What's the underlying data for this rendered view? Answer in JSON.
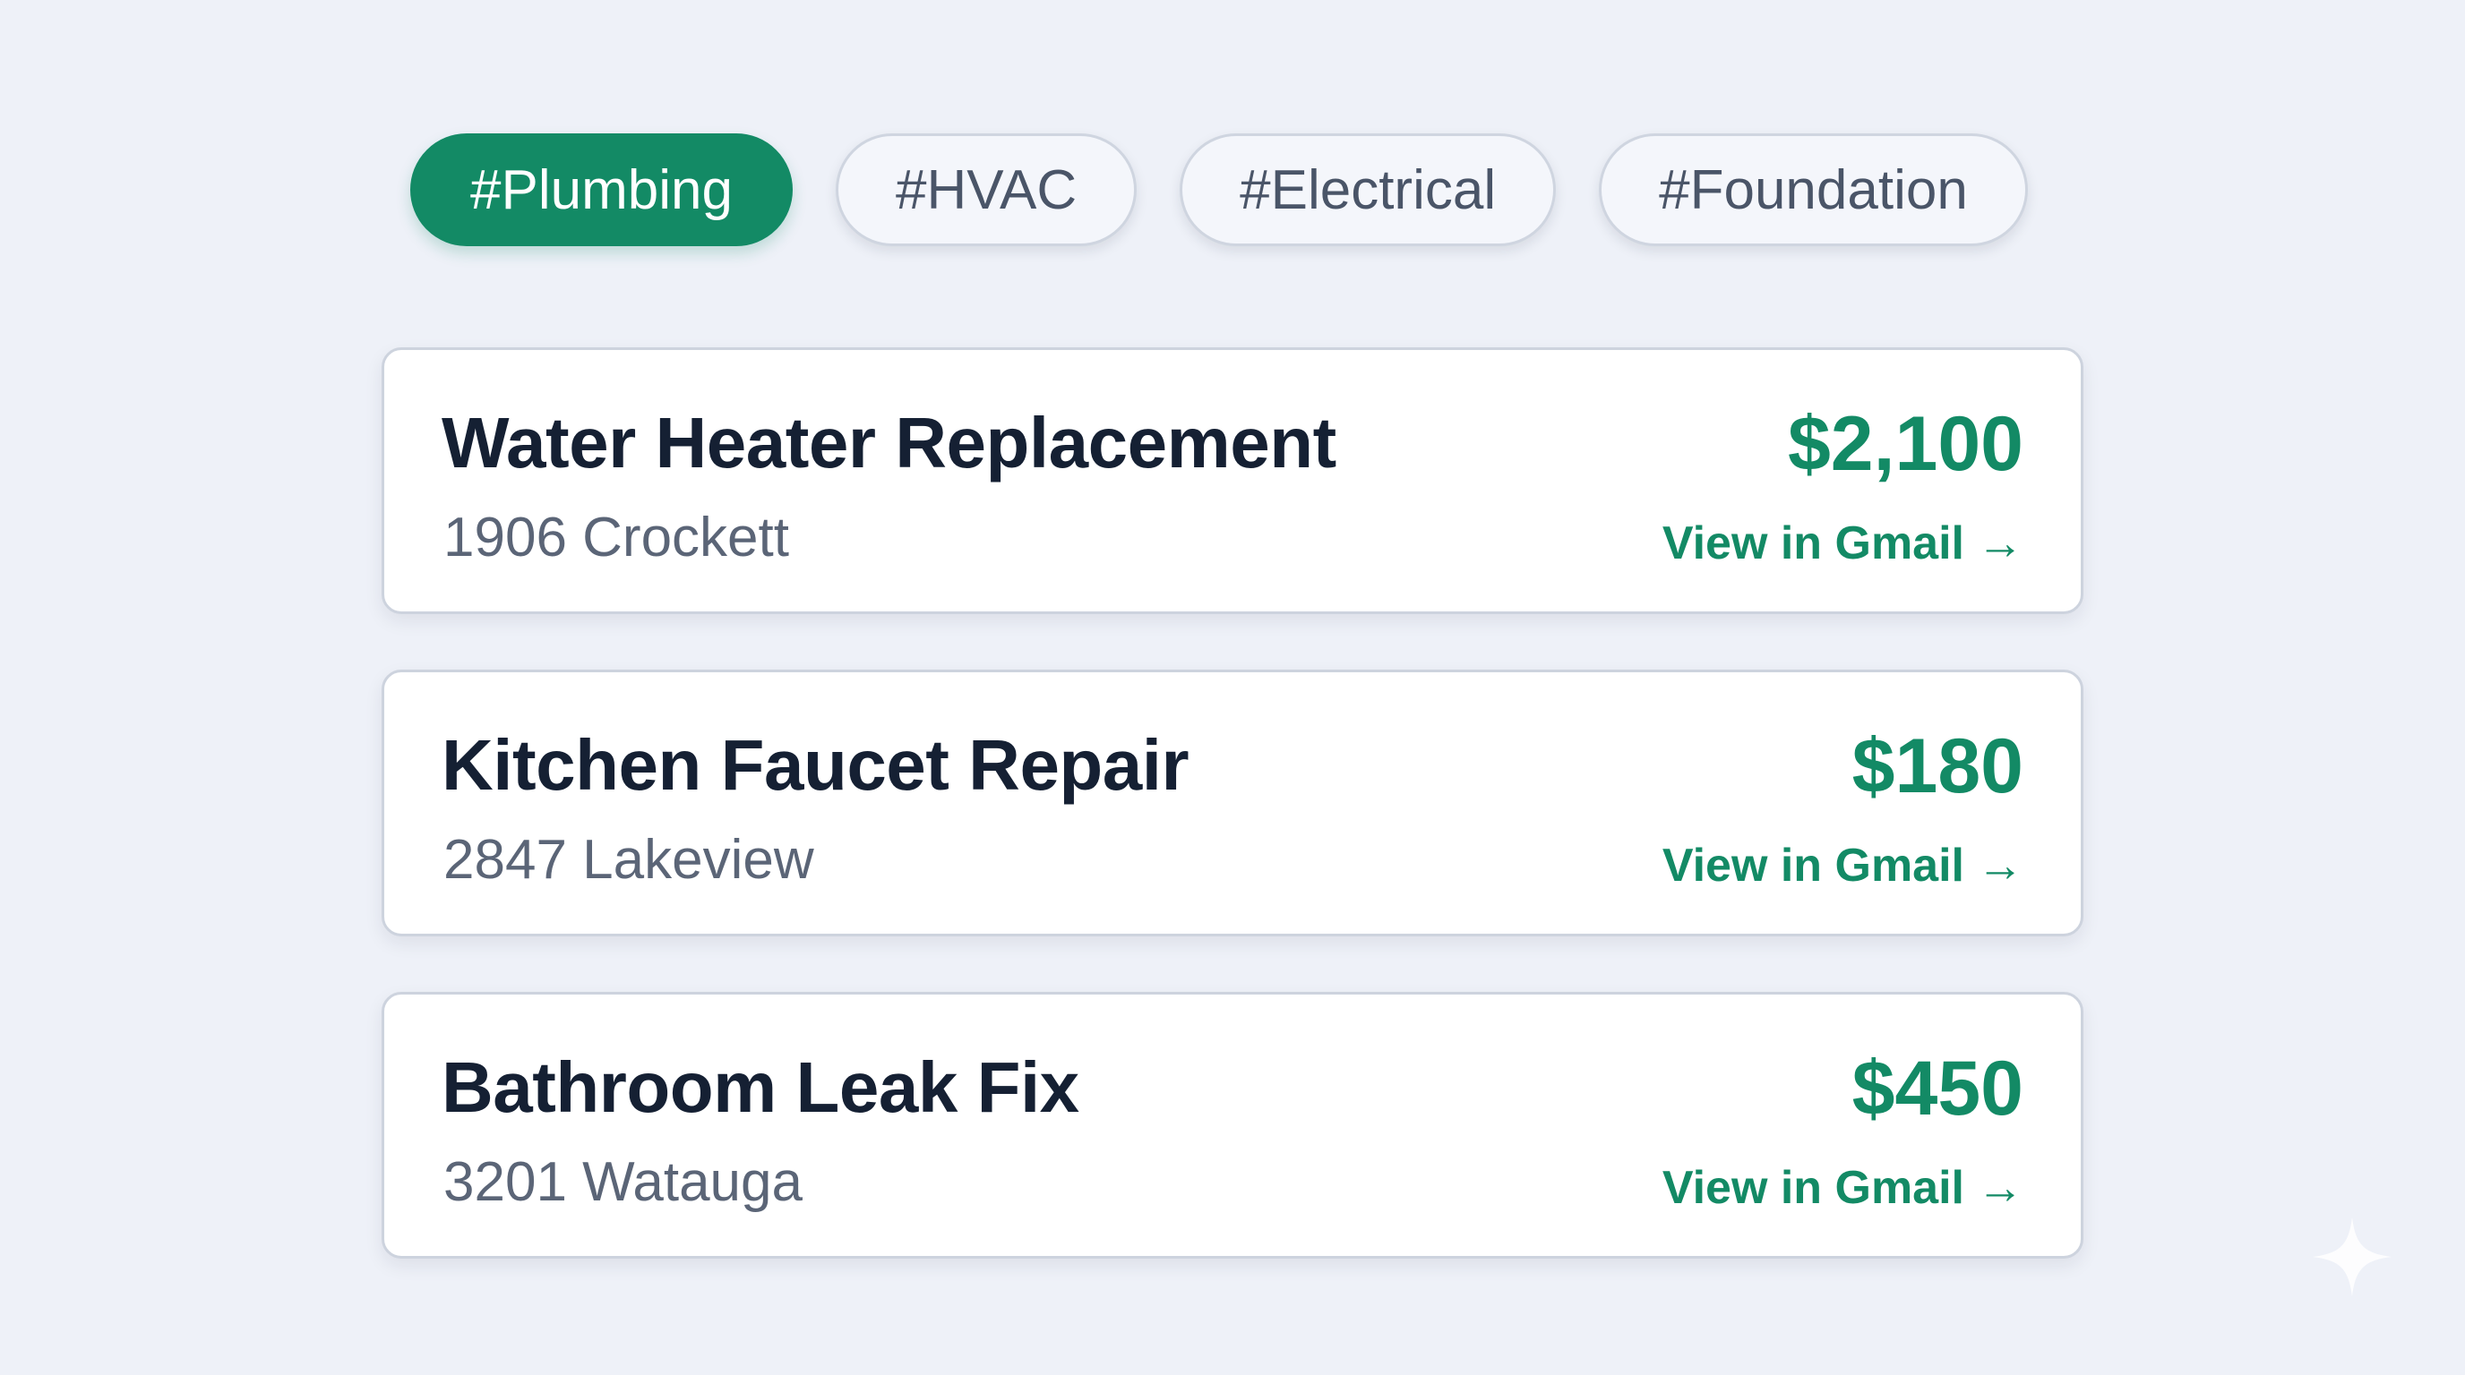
{
  "filters": [
    {
      "label": "#Plumbing",
      "active": true
    },
    {
      "label": "#HVAC",
      "active": false
    },
    {
      "label": "#Electrical",
      "active": false
    },
    {
      "label": "#Foundation",
      "active": false
    }
  ],
  "jobs": [
    {
      "title": "Water Heater Replacement",
      "address": "1906 Crockett",
      "price": "$2,100",
      "link_label": "View in Gmail"
    },
    {
      "title": "Kitchen Faucet Repair",
      "address": "2847 Lakeview",
      "price": "$180",
      "link_label": "View in Gmail"
    },
    {
      "title": "Bathroom Leak Fix",
      "address": "3201 Watauga",
      "price": "$450",
      "link_label": "View in Gmail"
    }
  ],
  "icons": {
    "link_arrow": "arrow-right-icon",
    "corner": "sparkle-icon"
  },
  "colors": {
    "accent": "#138a65",
    "background": "#eef1f8",
    "card": "#ffffff",
    "title": "#152033",
    "muted": "#5b6577"
  }
}
